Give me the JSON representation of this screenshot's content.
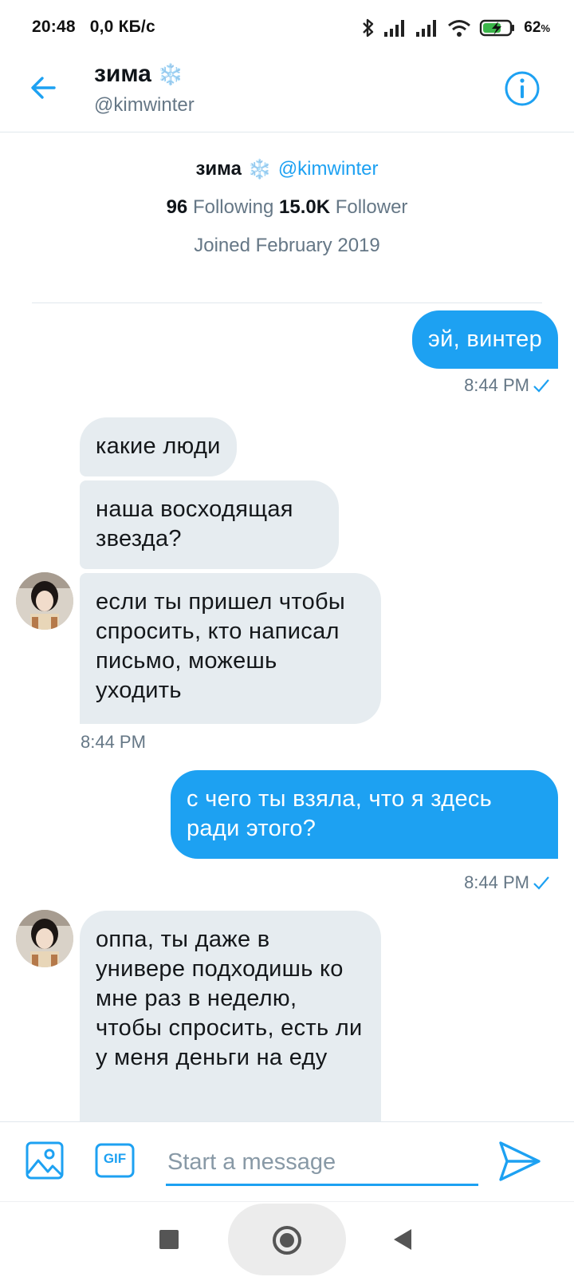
{
  "status_bar": {
    "time": "20:48",
    "network_speed": "0,0 КБ/с",
    "battery_percent": "62",
    "battery_suffix": "%",
    "icons": [
      "bluetooth-icon",
      "signal-icon",
      "signal-icon",
      "wifi-icon",
      "battery-charging-icon"
    ]
  },
  "header": {
    "name": "зима",
    "emoji": "❄️",
    "handle": "@kimwinter"
  },
  "profile": {
    "name": "зима",
    "emoji": "❄️",
    "handle": "@kimwinter",
    "following_count": "96",
    "following_label": "Following",
    "follower_count": "15.0K",
    "follower_label": "Follower",
    "joined": "Joined February 2019"
  },
  "messages": [
    {
      "sender": "me",
      "text": "эй, винтер",
      "time": "8:44 PM",
      "read": true
    },
    {
      "sender": "them",
      "text": "какие люди"
    },
    {
      "sender": "them",
      "text": "наша восходящая звезда?"
    },
    {
      "sender": "them",
      "text": "если ты пришел чтобы спросить, кто написал письмо, можешь уходить",
      "time": "8:44 PM"
    },
    {
      "sender": "me",
      "text": "с чего ты взяла, что я здесь ради этого?",
      "time": "8:44 PM",
      "read": true
    },
    {
      "sender": "them",
      "text": "оппа, ты даже в универе подходишь ко мне раз в неделю, чтобы спросить, есть ли у меня деньги на еду"
    }
  ],
  "composer": {
    "placeholder": "Start a message",
    "gif_label": "GIF"
  },
  "colors": {
    "accent": "#1da1f2",
    "received_bubble": "#e6ecf0",
    "secondary_text": "#657786"
  }
}
